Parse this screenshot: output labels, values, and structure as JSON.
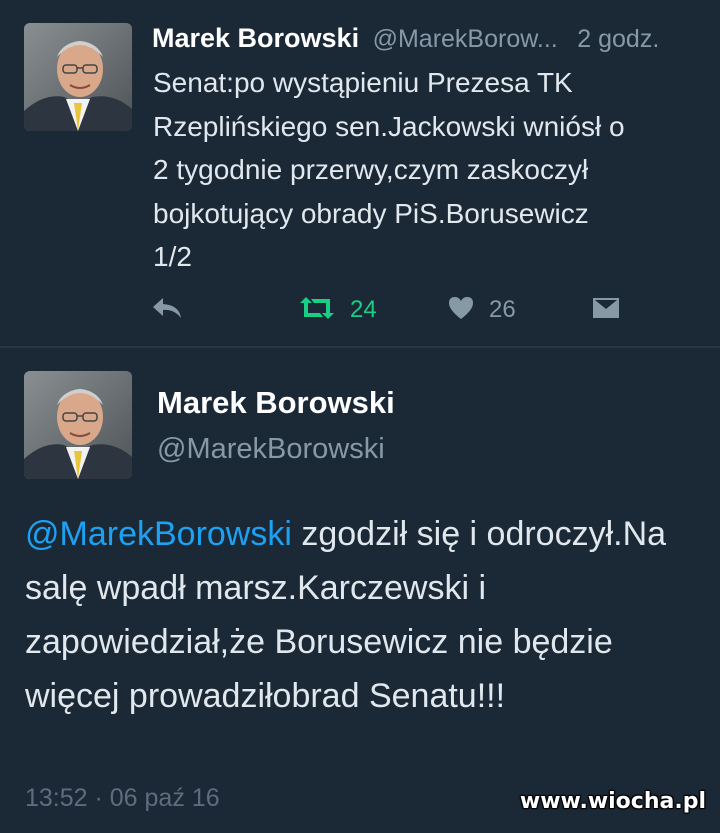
{
  "tweet1": {
    "author_name": "Marek Borowski",
    "author_handle": "@MarekBorow...",
    "time": "2 godz.",
    "text": "Senat:po wystąpieniu Prezesa TK\nRzeplińskiego sen.Jackowski wniósł o\n2 tygodnie przerwy,czym zaskoczył\nbojkotujący obrady PiS.Borusewicz\n1/2",
    "actions": {
      "reply_icon": "reply-icon",
      "retweet_icon": "retweet-icon",
      "retweet_count": "24",
      "like_icon": "heart-icon",
      "like_count": "26",
      "dm_icon": "direct-message-icon"
    }
  },
  "tweet2": {
    "author_name": "Marek Borowski",
    "author_handle": "@MarekBorowski",
    "mention": "@MarekBorowski",
    "text_after_mention": " zgodził się i odroczył.Na salę wpadł marsz.Karczewski i zapowiedział,że Borusewicz nie będzie więcej prowadziłobrad Senatu!!!",
    "timestamp": "13:52 · 06 paź 16"
  },
  "watermark": "www.wiocha.pl",
  "colors": {
    "background": "#1b2836",
    "text": "#e1e8ed",
    "secondary": "#8899a6",
    "link": "#1da1f2",
    "retweet_green": "#19cf86"
  }
}
